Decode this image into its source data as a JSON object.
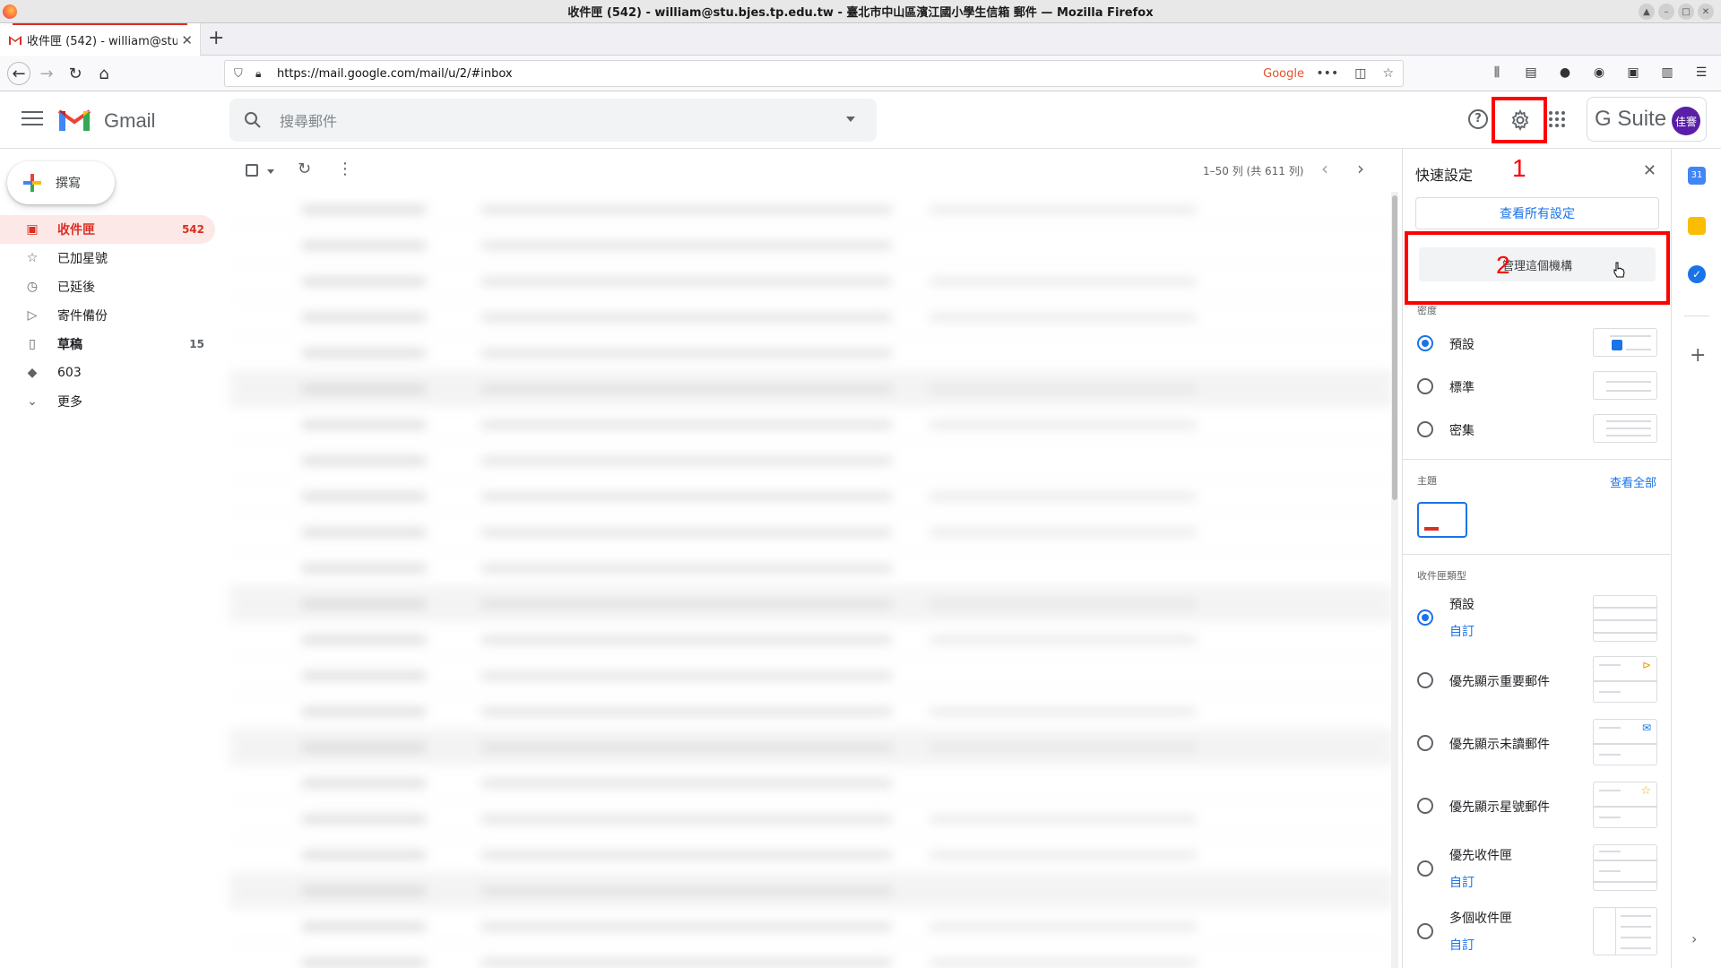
{
  "browser": {
    "window_title": "收件匣 (542) - william@stu.bjes.tp.edu.tw - 臺北市中山區濱江國小學生信箱 郵件 — Mozilla Firefox",
    "tab_label": "收件匣 (542) - william@stu.bjes",
    "url": "https://mail.google.com/mail/u/2/#inbox",
    "google_badge": "Google"
  },
  "gmail": {
    "brand": "Gmail",
    "search_placeholder": "搜尋郵件",
    "suite": "G Suite",
    "avatar_text": "佳謇",
    "compose_label": "撰寫",
    "nav": [
      {
        "label": "收件匣",
        "count": "542",
        "icon": "inbox-icon"
      },
      {
        "label": "已加星號",
        "count": "",
        "icon": "star-icon"
      },
      {
        "label": "已延後",
        "count": "",
        "icon": "clock-icon"
      },
      {
        "label": "寄件備份",
        "count": "",
        "icon": "send-icon"
      },
      {
        "label": "草稿",
        "count": "15",
        "icon": "draft-icon"
      },
      {
        "label": "603",
        "count": "",
        "icon": "label-icon"
      },
      {
        "label": "更多",
        "count": "",
        "icon": "chevron-down-icon"
      }
    ],
    "pager_text": "1–50 列 (共 611 列)"
  },
  "quick_settings": {
    "title": "快速設定",
    "view_all_settings": "查看所有設定",
    "manage_org": "管理這個機構",
    "density_label": "密度",
    "density_options": [
      "預設",
      "標準",
      "密集"
    ],
    "theme_label": "主題",
    "theme_view_all": "查看全部",
    "inbox_type_label": "收件匣類型",
    "inbox_types": [
      {
        "label": "預設",
        "sub": "自訂"
      },
      {
        "label": "優先顯示重要郵件",
        "sub": ""
      },
      {
        "label": "優先顯示未讀郵件",
        "sub": ""
      },
      {
        "label": "優先顯示星號郵件",
        "sub": ""
      },
      {
        "label": "優先收件匣",
        "sub": "自訂"
      },
      {
        "label": "多個收件匣",
        "sub": "自訂"
      }
    ]
  },
  "annotations": {
    "mark1": "1",
    "mark2": "2",
    "color": "#ff0000"
  }
}
